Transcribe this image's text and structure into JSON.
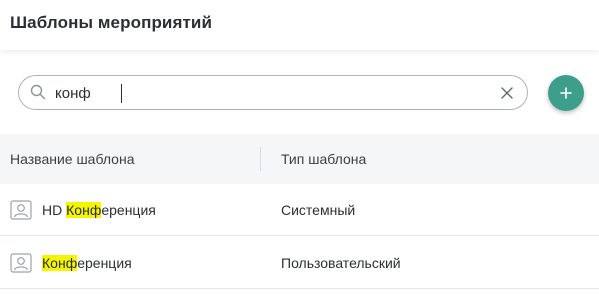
{
  "header": {
    "title": "Шаблоны мероприятий"
  },
  "search": {
    "value": "конф",
    "placeholder": ""
  },
  "colors": {
    "accent": "#3d9e8c",
    "highlight": "#f5f500"
  },
  "table": {
    "columns": [
      "Название шаблона",
      "Тип шаблона"
    ],
    "rows": [
      {
        "name_prefix": "HD ",
        "name_match": "Кон",
        "name_match2": "ф",
        "name_rest": "еренция",
        "type": "Системный",
        "icon": "user-icon"
      },
      {
        "name_prefix": "",
        "name_match": "Кон",
        "name_match2": "ф",
        "name_rest": "еренция",
        "type": "Пользовательский",
        "icon": "user-icon"
      }
    ]
  },
  "icons": {
    "search": "search-icon",
    "clear": "close-icon",
    "add": "plus-icon"
  }
}
